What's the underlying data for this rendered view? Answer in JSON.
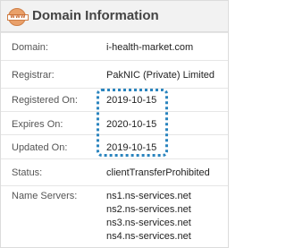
{
  "header": {
    "icon": "www-globe-icon",
    "icon_text": "WWW",
    "title": "Domain Information"
  },
  "fields": {
    "domain": {
      "label": "Domain:",
      "value": "i-health-market.com"
    },
    "registrar": {
      "label": "Registrar:",
      "value": "PakNIC (Private) Limited"
    },
    "registered_on": {
      "label": "Registered On:",
      "value": "2019-10-15"
    },
    "expires_on": {
      "label": "Expires On:",
      "value": "2020-10-15"
    },
    "updated_on": {
      "label": "Updated On:",
      "value": "2019-10-15"
    },
    "status": {
      "label": "Status:",
      "value": "clientTransferProhibited"
    },
    "name_servers": {
      "label": "Name Servers:",
      "values": [
        "ns1.ns-services.net",
        "ns2.ns-services.net",
        "ns3.ns-services.net",
        "ns4.ns-services.net"
      ]
    }
  },
  "colors": {
    "highlight_border": "#2a84be",
    "icon_fill": "#e9a06a",
    "header_bg": "#f2f2f2"
  }
}
